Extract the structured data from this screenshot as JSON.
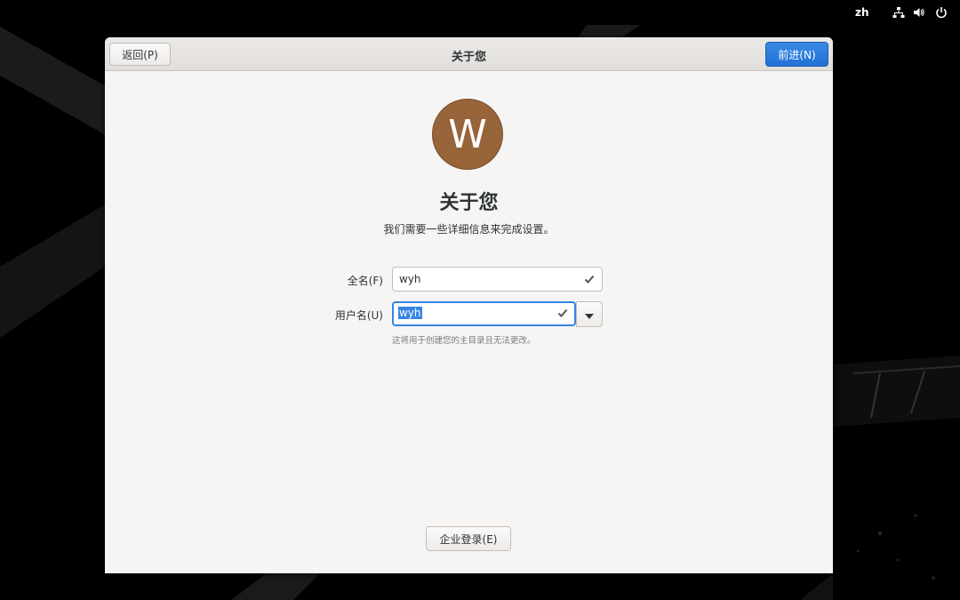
{
  "topbar": {
    "language": "zh",
    "icons": [
      "network-icon",
      "volume-icon",
      "power-icon"
    ]
  },
  "window": {
    "title": "关于您",
    "back_label": "返回(P)",
    "next_label": "前进(N)"
  },
  "avatar": {
    "initial": "W",
    "color": "#98643a"
  },
  "main": {
    "title": "关于您",
    "subtitle": "我们需要一些详细信息来完成设置。"
  },
  "form": {
    "fullname_label": "全名(F)",
    "fullname_value": "wyh",
    "username_label": "用户名(U)",
    "username_value": "wyh",
    "username_hint": "这将用于创建您的主目录且无法更改。"
  },
  "footer": {
    "enterprise_label": "企业登录(E)"
  },
  "colors": {
    "accent": "#3584e4",
    "background": "#000000",
    "window_bg": "#f6f5f4"
  }
}
